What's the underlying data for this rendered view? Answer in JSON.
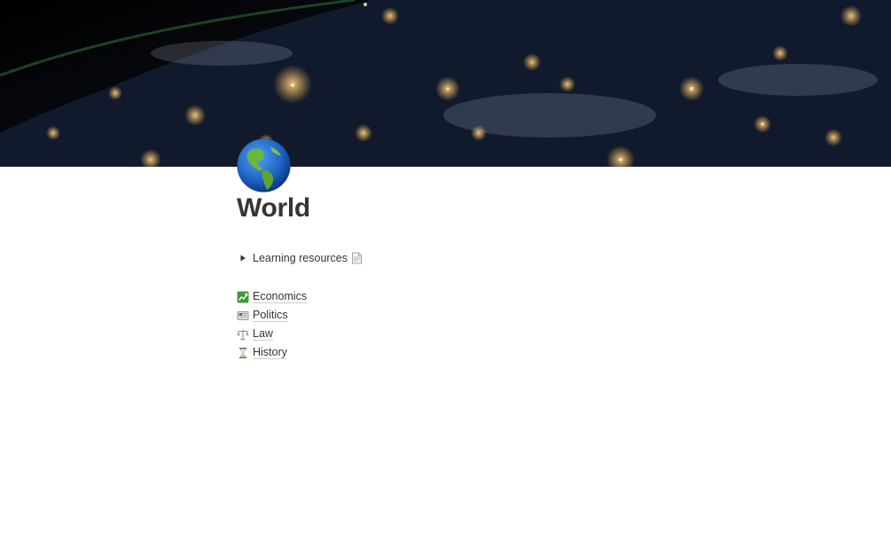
{
  "page": {
    "title": "World",
    "icon": "earth-americas-icon"
  },
  "toggle": {
    "label": "Learning resources",
    "icon": "document-icon",
    "collapsed": true
  },
  "links": [
    {
      "label": "Economics",
      "icon": "chart-increasing-icon"
    },
    {
      "label": "Politics",
      "icon": "newspaper-icon"
    },
    {
      "label": "Law",
      "icon": "balance-scale-icon"
    },
    {
      "label": "History",
      "icon": "hourglass-icon"
    }
  ],
  "colors": {
    "text": "#37352f",
    "background": "#ffffff"
  }
}
